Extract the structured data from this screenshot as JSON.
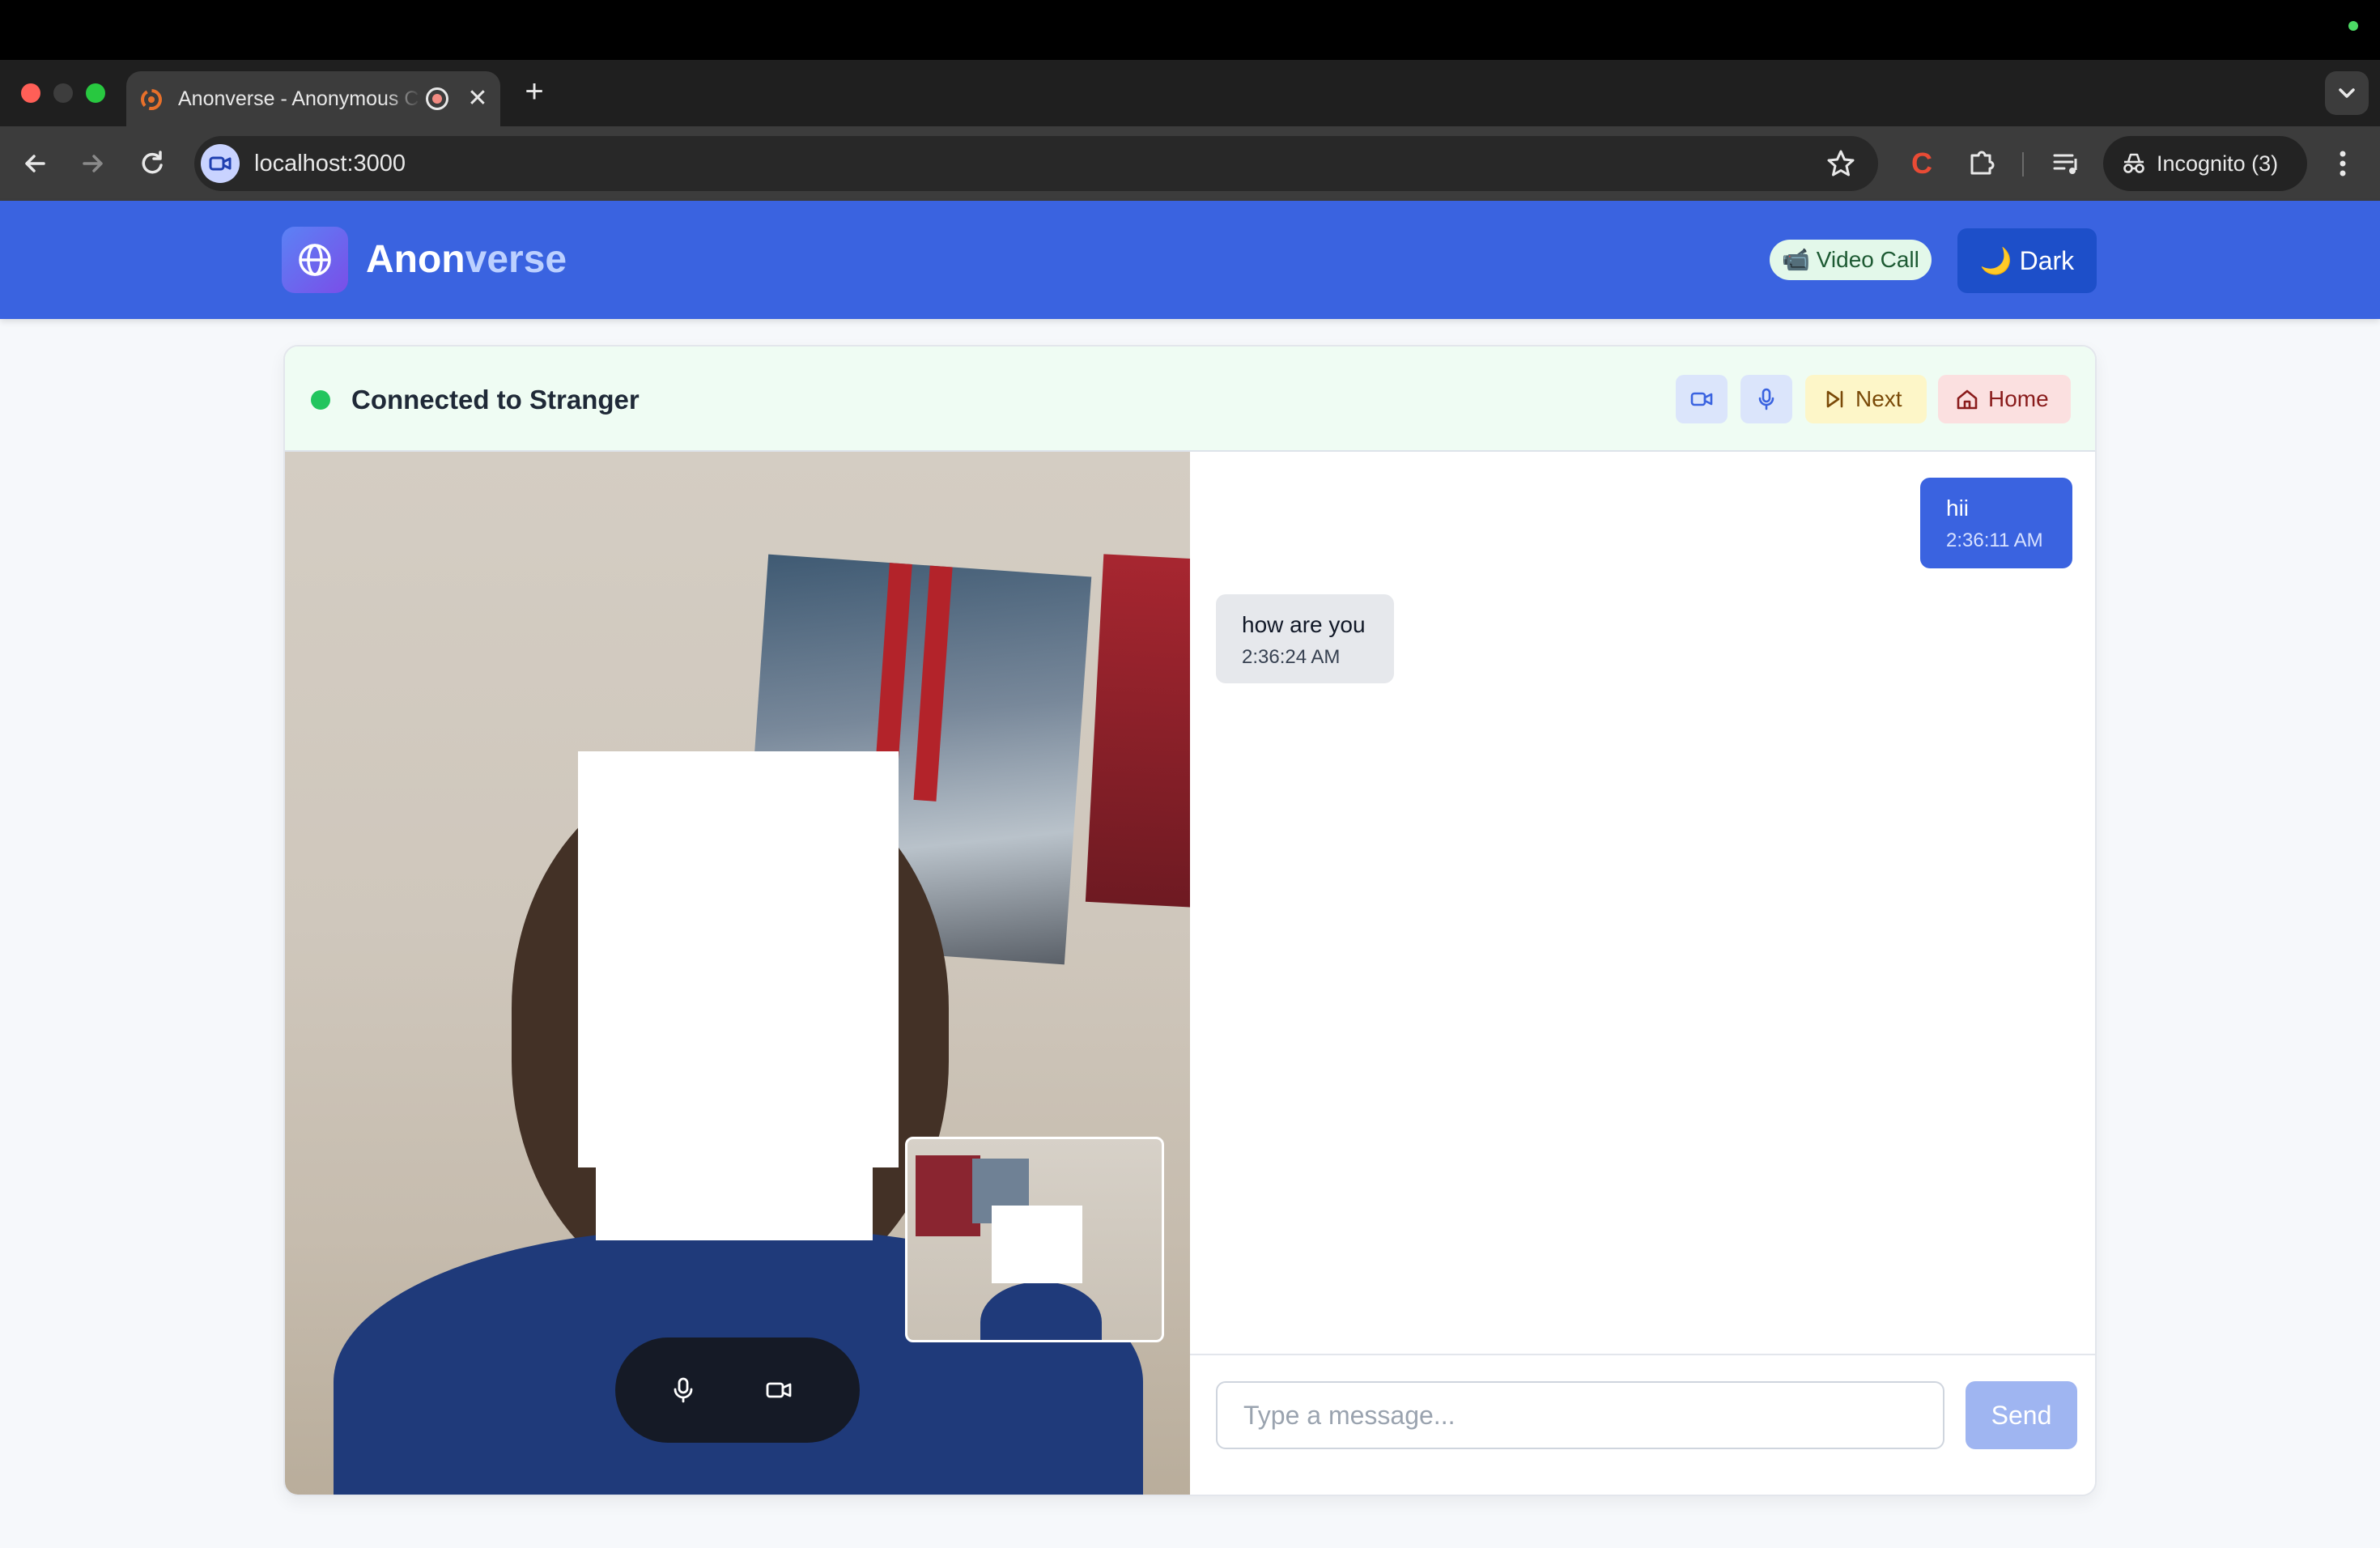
{
  "browser": {
    "tab_title": "Anonverse - Anonymous Chat",
    "tab_close": "✕",
    "new_tab": "+",
    "url": "localhost:3000",
    "extension_label": "C",
    "profile_label": "Incognito (3)"
  },
  "header": {
    "brand_part1": "Anon",
    "brand_part2": "verse",
    "video_call_badge": "📹 Video Call",
    "theme_button": "🌙 Dark"
  },
  "session": {
    "status": "Connected to Stranger",
    "next_label": "Next",
    "home_label": "Home"
  },
  "messages": [
    {
      "sender": "you",
      "text": "hii",
      "time": "2:36:11 AM"
    },
    {
      "sender": "stranger",
      "text": "how are you",
      "time": "2:36:24 AM"
    }
  ],
  "composer": {
    "placeholder": "Type a message...",
    "send_label": "Send"
  },
  "colors": {
    "brand": "#3a63e0",
    "status_connected": "#22c55e"
  }
}
